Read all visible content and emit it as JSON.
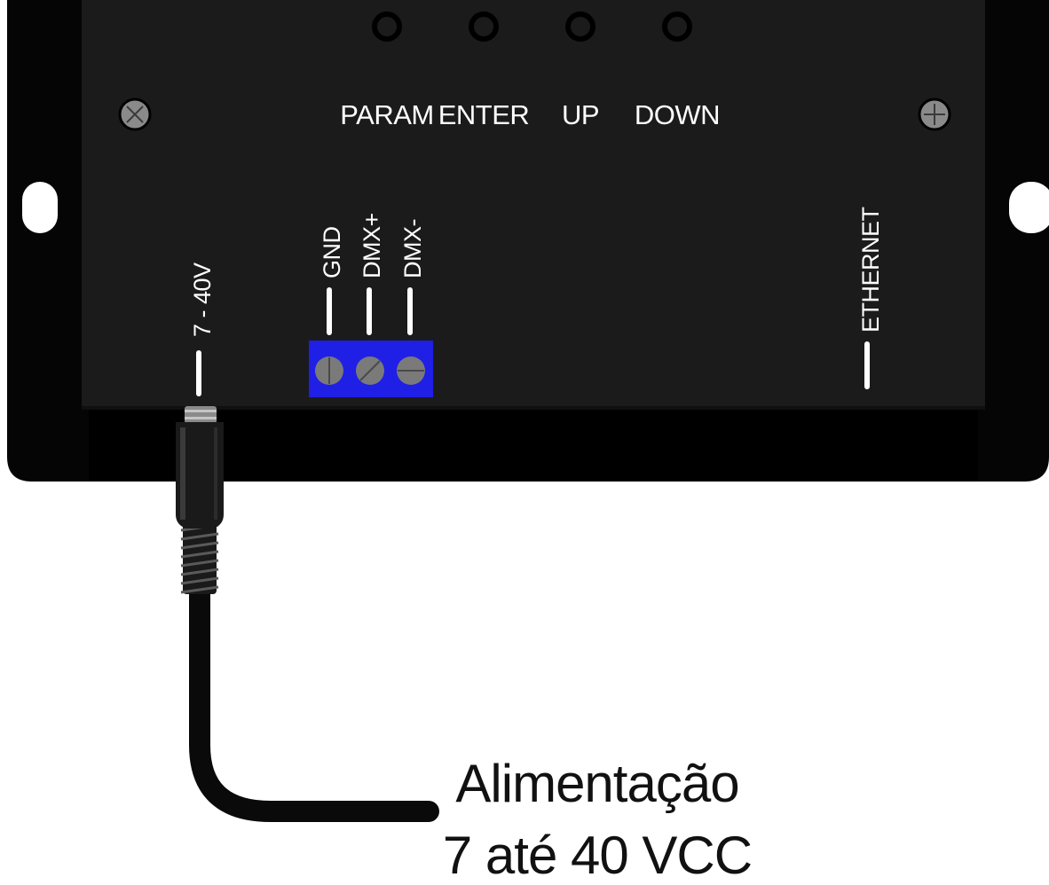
{
  "device": {
    "buttons": [
      "PARAM",
      "ENTER",
      "UP",
      "DOWN"
    ],
    "power_port_label": "7 - 40V",
    "terminal_labels": [
      "GND",
      "DMX+",
      "DMX-"
    ],
    "ethernet_label": "ETHERNET",
    "colors": {
      "body": "#1b1b1b",
      "flange": "#050505",
      "terminal_block": "#1f1fe6",
      "screw": "#7a7a7a",
      "label": "#ffffff"
    }
  },
  "caption": {
    "line1": "Alimentação",
    "line2": "7 até 40 VCC"
  }
}
